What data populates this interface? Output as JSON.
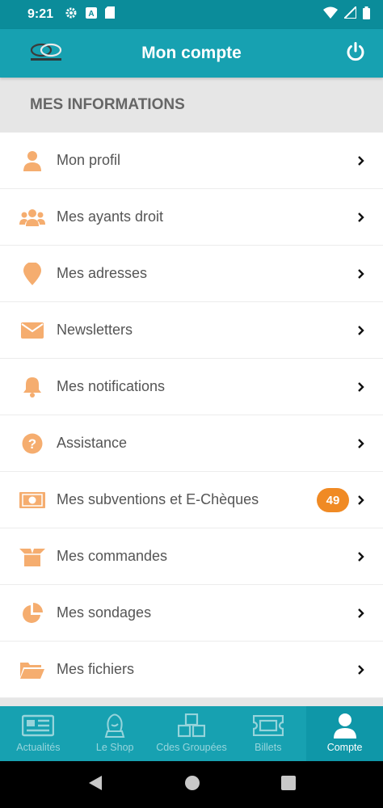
{
  "status_bar": {
    "time": "9:21",
    "left_icons": [
      "gear-icon",
      "a-icon",
      "sd-card-icon"
    ],
    "right_icons": [
      "wifi-icon",
      "signal-icon",
      "battery-icon"
    ]
  },
  "header": {
    "title": "Mon compte",
    "logo": "logo-rings",
    "power_icon": "power-icon"
  },
  "section": {
    "title": "MES INFORMATIONS"
  },
  "menu": {
    "items": [
      {
        "label": "Mon profil",
        "icon": "user-icon"
      },
      {
        "label": "Mes ayants droit",
        "icon": "users-icon"
      },
      {
        "label": "Mes adresses",
        "icon": "map-pin-icon"
      },
      {
        "label": "Newsletters",
        "icon": "envelope-icon"
      },
      {
        "label": "Mes notifications",
        "icon": "bell-icon"
      },
      {
        "label": "Assistance",
        "icon": "question-circle-icon"
      },
      {
        "label": "Mes subventions et E-Chèques",
        "icon": "money-bill-icon",
        "badge": "49"
      },
      {
        "label": "Mes commandes",
        "icon": "open-box-icon"
      },
      {
        "label": "Mes sondages",
        "icon": "pie-chart-icon"
      },
      {
        "label": "Mes fichiers",
        "icon": "folder-open-icon"
      }
    ]
  },
  "bottom_nav": {
    "tabs": [
      {
        "label": "Actualités",
        "icon": "newspaper-icon",
        "active": false
      },
      {
        "label": "Le Shop",
        "icon": "shop-icon",
        "active": false
      },
      {
        "label": "Cdes Groupées",
        "icon": "cubes-icon",
        "active": false
      },
      {
        "label": "Billets",
        "icon": "ticket-icon",
        "active": false
      },
      {
        "label": "Compte",
        "icon": "user-icon",
        "active": true
      }
    ]
  },
  "colors": {
    "header": "#17a1b1",
    "status_bar": "#0b8c9a",
    "icon_orange": "#f5ad6f",
    "badge": "#f08a24",
    "section_bg": "#e6e6e6"
  }
}
